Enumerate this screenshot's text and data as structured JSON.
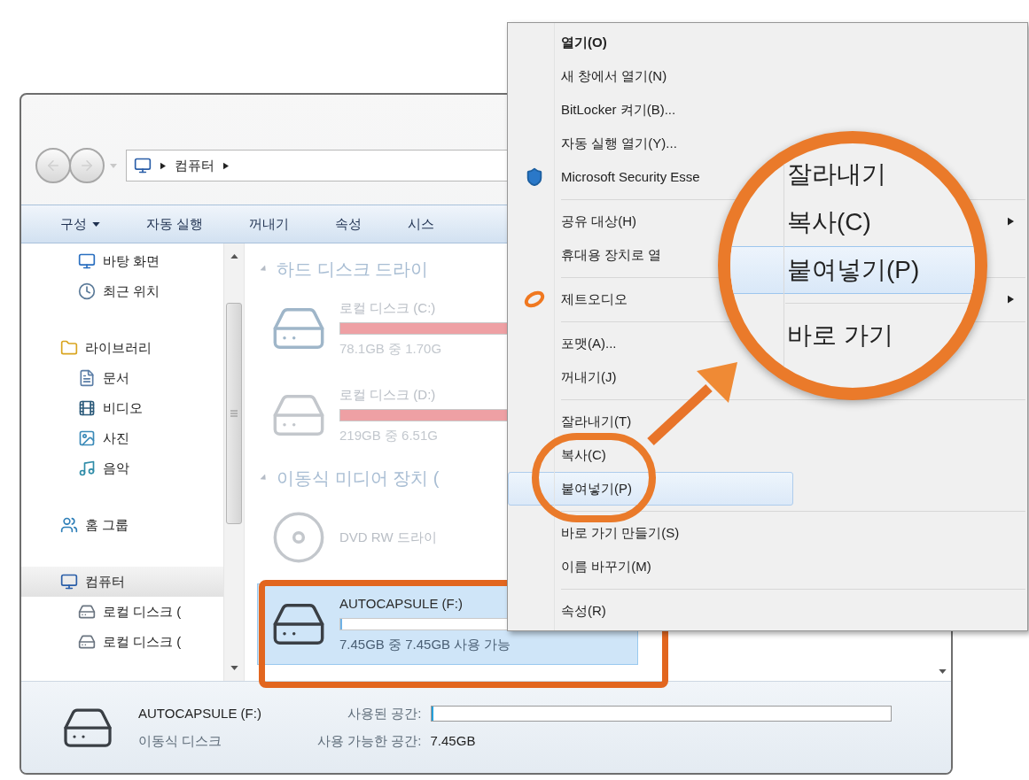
{
  "explorer": {
    "address": [
      "컴퓨터"
    ],
    "toolbar": [
      {
        "label": "구성",
        "dropdown": true
      },
      {
        "label": "자동 실행",
        "dropdown": false
      },
      {
        "label": "꺼내기",
        "dropdown": false
      },
      {
        "label": "속성",
        "dropdown": false
      },
      {
        "label": "시스",
        "dropdown": false
      }
    ],
    "sidebar": {
      "sections": [
        {
          "children": [
            {
              "label": "바탕 화면",
              "selected": false
            },
            {
              "label": "최근 위치",
              "selected": false
            }
          ]
        },
        {
          "label": "라이브러리",
          "selected": false,
          "children": [
            {
              "label": "문서",
              "selected": false
            },
            {
              "label": "비디오",
              "selected": false
            },
            {
              "label": "사진",
              "selected": false
            },
            {
              "label": "음악",
              "selected": false
            }
          ]
        },
        {
          "label": "홈 그룹",
          "selected": false
        },
        {
          "label": "컴퓨터",
          "selected": true,
          "children": [
            {
              "label": "로컬 디스크 (",
              "selected": false
            },
            {
              "label": "로컬 디스크 (",
              "selected": false
            }
          ]
        }
      ]
    },
    "content": {
      "groups": [
        {
          "title": "하드 디스크 드라이",
          "drives": [
            {
              "name": "로컬 디스크 (C:)",
              "level": 0.98,
              "info": "78.1GB 중 1.70G",
              "selected": false
            },
            {
              "name": "로컬 디스크 (D:)",
              "level": 0.97,
              "info": "219GB 중 6.51G",
              "selected": false
            }
          ]
        },
        {
          "title": "이동식 미디어 장치 (",
          "drives": [
            {
              "name": "DVD RW 드라이",
              "selected": false
            },
            {
              "name": "AUTOCAPSULE (F:)",
              "level": 0,
              "info": "7.45GB 중 7.45GB 사용 가능",
              "selected": true
            }
          ]
        }
      ]
    },
    "details": {
      "name": "AUTOCAPSULE (F:)",
      "type": "이동식 디스크",
      "used": {
        "label": "사용된 공간:",
        "level": 0
      },
      "free": {
        "label": "사용 가능한 공간:",
        "value": "7.45GB"
      }
    }
  },
  "context_menu": {
    "items": [
      {
        "kind": "item",
        "label": "열기(O)",
        "default": true,
        "selected": false
      },
      {
        "kind": "item",
        "label": "새 창에서 열기(N)",
        "selected": false
      },
      {
        "kind": "item",
        "label": "BitLocker 켜기(B)...",
        "selected": false
      },
      {
        "kind": "item",
        "label": "자동 실행 열기(Y)...",
        "selected": false
      },
      {
        "kind": "item",
        "label": "Microsoft Security Esse",
        "selected": false
      },
      {
        "kind": "separator"
      },
      {
        "kind": "item",
        "label": "공유 대상(H)",
        "submenu": true,
        "selected": false
      },
      {
        "kind": "item",
        "label": "휴대용 장치로 열",
        "selected": false
      },
      {
        "kind": "separator"
      },
      {
        "kind": "item",
        "label": "제트오디오",
        "submenu": true,
        "selected": false
      },
      {
        "kind": "separator"
      },
      {
        "kind": "item",
        "label": "포맷(A)...",
        "selected": false
      },
      {
        "kind": "item",
        "label": "꺼내기(J)",
        "selected": false
      },
      {
        "kind": "separator"
      },
      {
        "kind": "item",
        "label": "잘라내기(T)",
        "selected": false
      },
      {
        "kind": "item",
        "label": "복사(C)",
        "selected": false
      },
      {
        "kind": "item",
        "label": "붙여넣기(P)",
        "selected": true
      },
      {
        "kind": "separator"
      },
      {
        "kind": "item",
        "label": "바로 가기 만들기(S)",
        "selected": false
      },
      {
        "kind": "item",
        "label": "이름 바꾸기(M)",
        "selected": false
      },
      {
        "kind": "separator"
      },
      {
        "kind": "item",
        "label": "속성(R)",
        "selected": false
      }
    ]
  },
  "magnifier": {
    "items": [
      {
        "kind": "item",
        "label": "잘라내기",
        "selected": false
      },
      {
        "kind": "item",
        "label": "복사(C)",
        "selected": false
      },
      {
        "kind": "item",
        "label": "붙여넣기(P)",
        "selected": true
      },
      {
        "kind": "separator"
      },
      {
        "kind": "item",
        "label": "바로 가기",
        "selected": false
      }
    ]
  }
}
